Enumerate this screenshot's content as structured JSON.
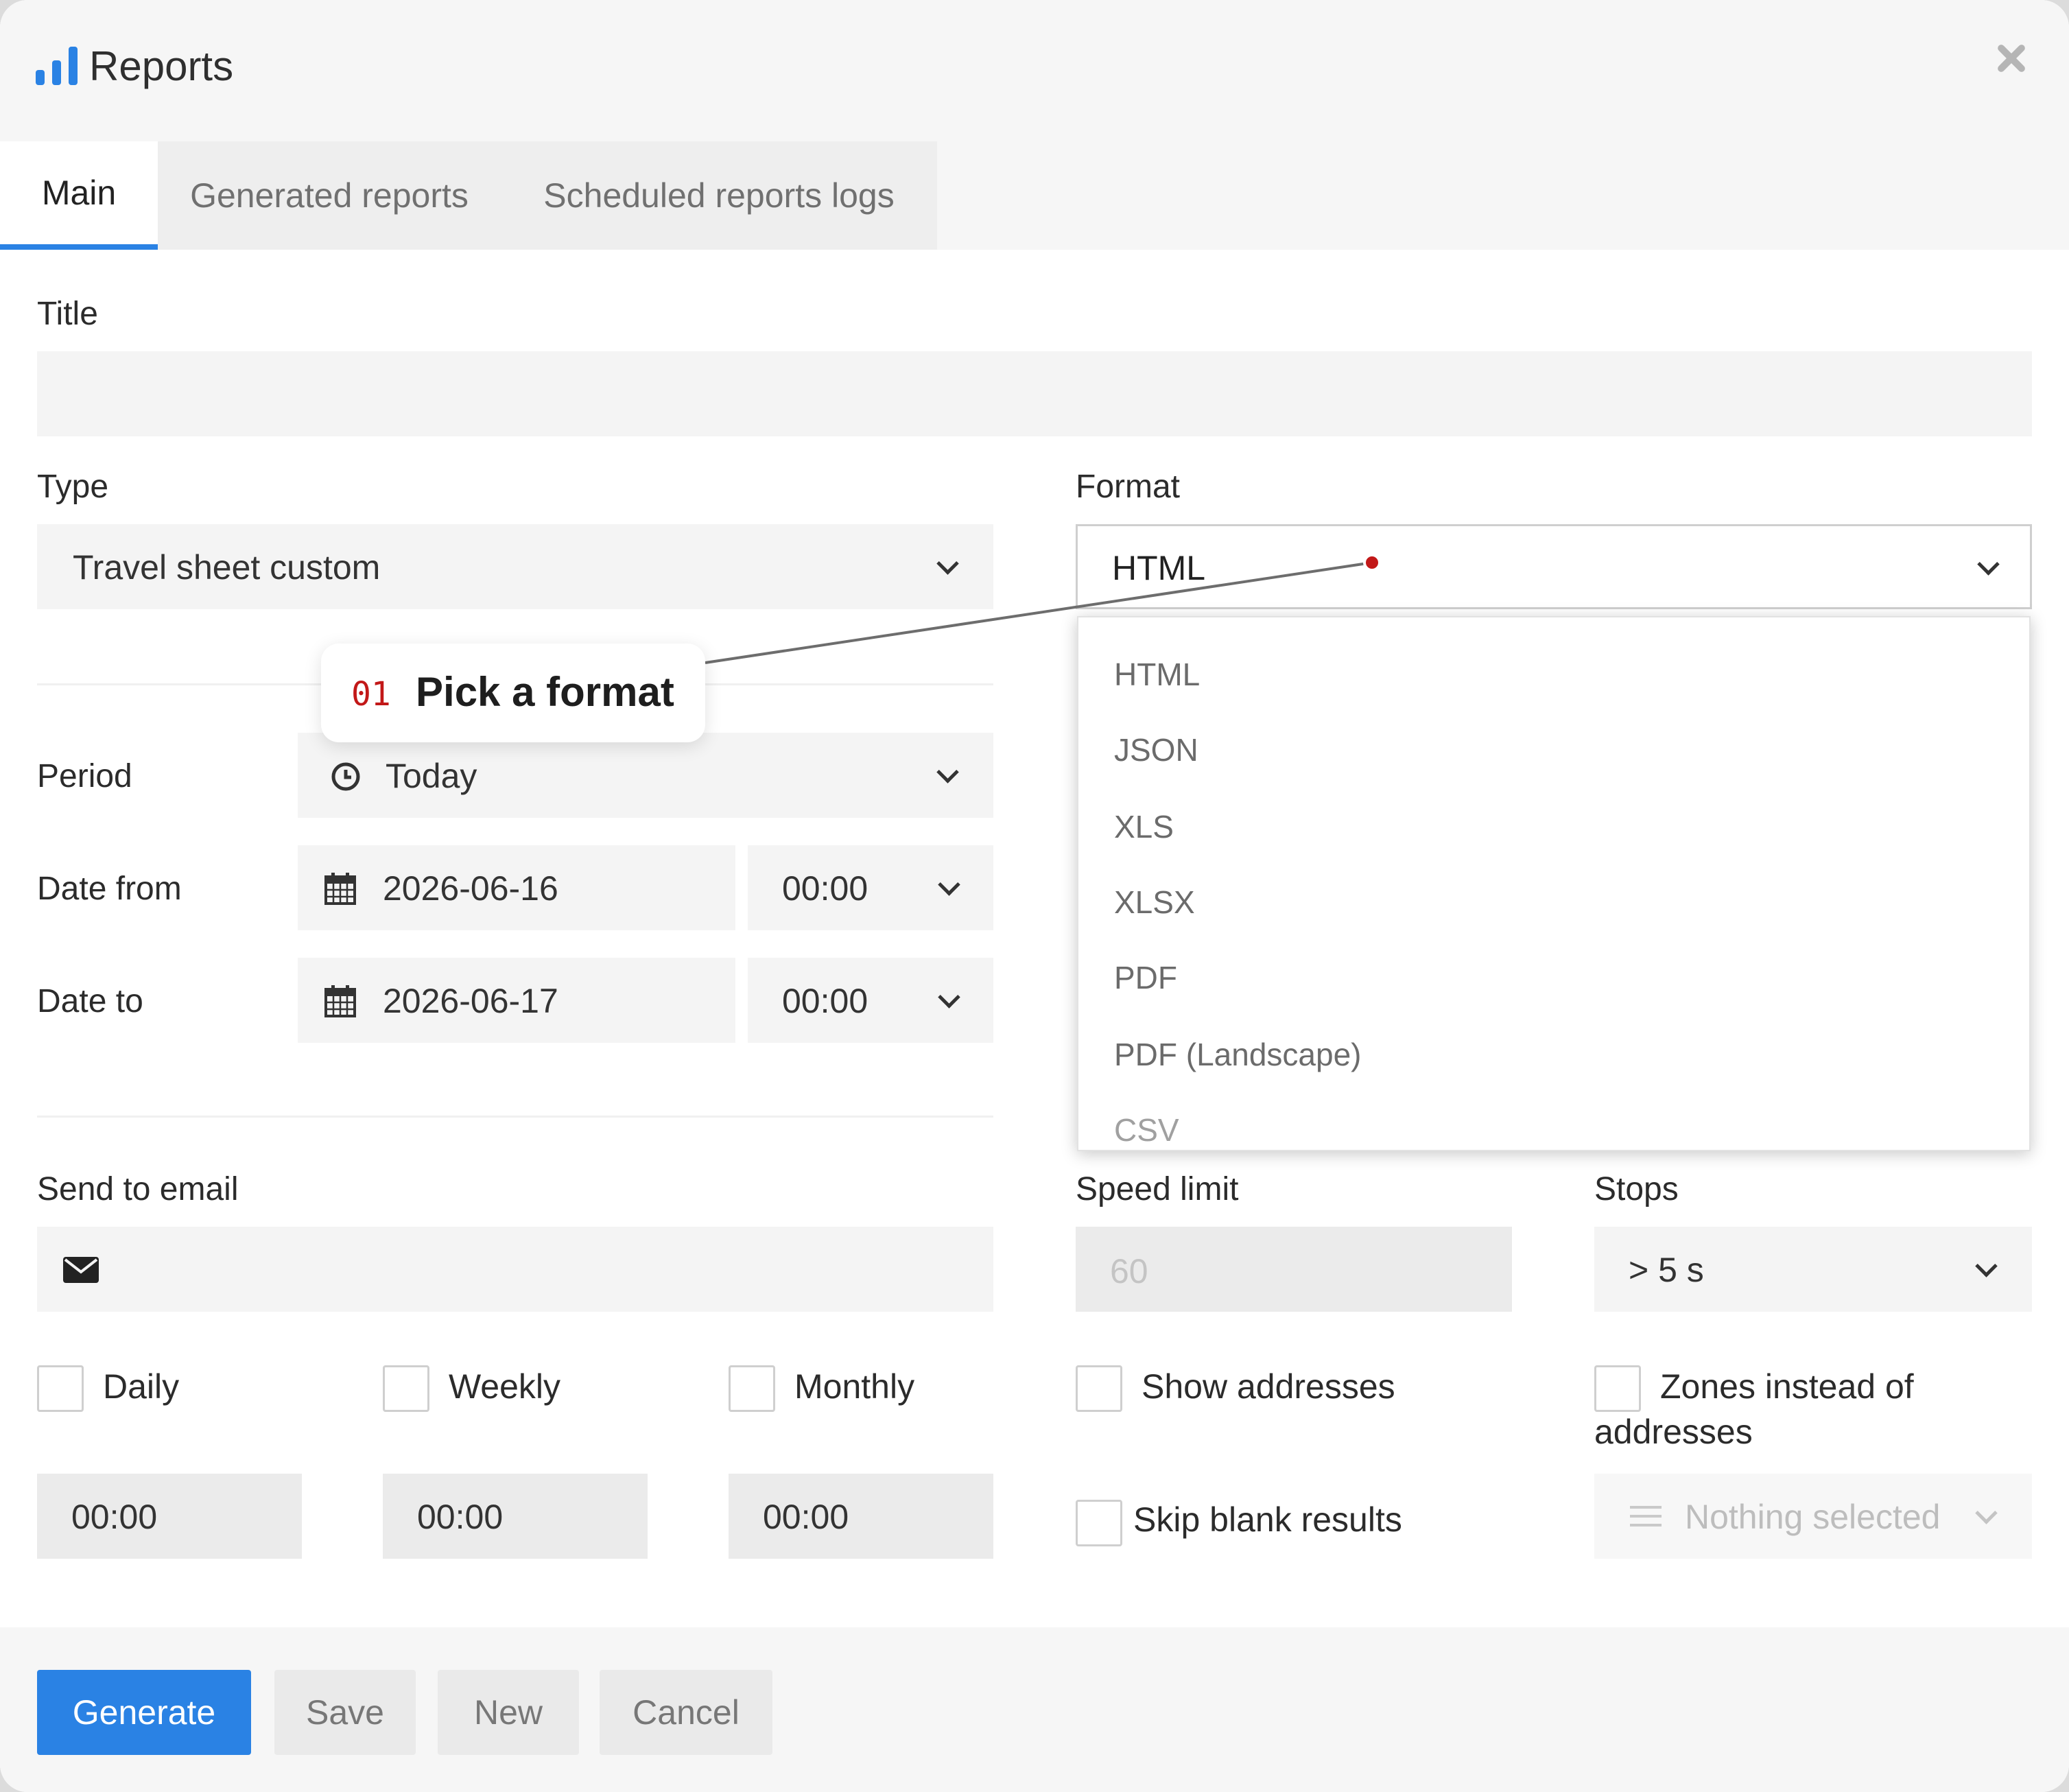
{
  "window": {
    "title": "Reports"
  },
  "tabs": [
    {
      "label": "Main",
      "active": true
    },
    {
      "label": "Generated reports",
      "active": false
    },
    {
      "label": "Scheduled reports logs",
      "active": false
    }
  ],
  "form": {
    "title_label": "Title",
    "title_value": "",
    "type_label": "Type",
    "type_value": "Travel sheet custom",
    "format_label": "Format",
    "format_value": "HTML",
    "format_options": [
      "HTML",
      "JSON",
      "XLS",
      "XLSX",
      "PDF",
      "PDF (Landscape)",
      "CSV"
    ],
    "period_label": "Period",
    "period_value": "Today",
    "date_from_label": "Date from",
    "date_from_value": "2026-06-16",
    "date_from_time": "00:00",
    "date_to_label": "Date to",
    "date_to_value": "2026-06-17",
    "date_to_time": "00:00",
    "send_to_email_label": "Send to email",
    "speed_limit_label": "Speed limit",
    "speed_limit_placeholder": "60",
    "stops_label": "Stops",
    "stops_value": "> 5 s",
    "daily_label": "Daily",
    "weekly_label": "Weekly",
    "monthly_label": "Monthly",
    "daily_time": "00:00",
    "weekly_time": "00:00",
    "monthly_time": "00:00",
    "show_addresses_label": "Show addresses",
    "zones_label_line1": "Zones instead of",
    "zones_label_line2": "addresses",
    "skip_blank_label": "Skip blank results",
    "zones_select_placeholder": "Nothing selected"
  },
  "buttons": {
    "generate": "Generate",
    "save": "Save",
    "new": "New",
    "cancel": "Cancel"
  },
  "callout": {
    "number": "01",
    "text": "Pick a format"
  },
  "colors": {
    "accent": "#2a82e4",
    "callout_number": "#c21818"
  },
  "icons": [
    "bar-chart-icon",
    "close-icon",
    "clock-icon",
    "calendar-icon",
    "envelope-icon",
    "list-icon",
    "chevron-down-icon"
  ]
}
